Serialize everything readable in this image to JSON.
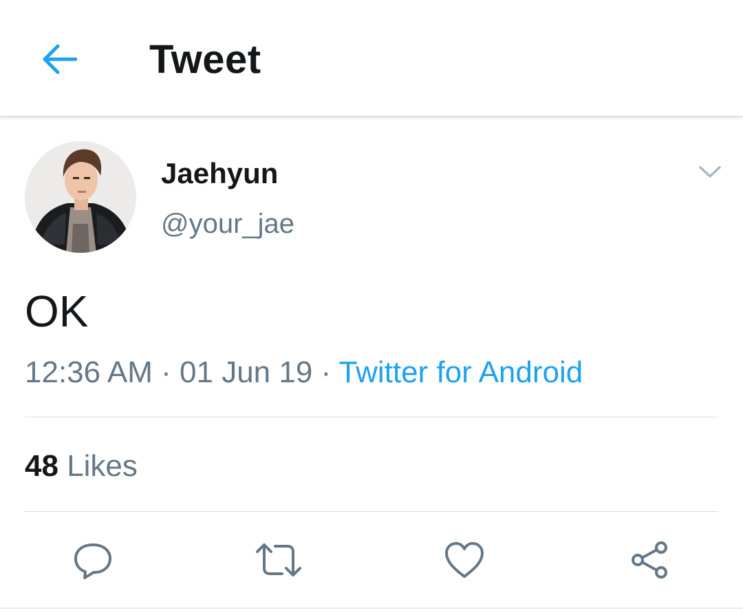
{
  "header": {
    "title": "Tweet",
    "back_icon": "arrow-left-icon",
    "accent_color": "#1da1f2"
  },
  "tweet": {
    "author": {
      "display_name": "Jaehyun",
      "handle": "@your_jae",
      "avatar_icon": "profile-photo"
    },
    "text": "OK",
    "meta": {
      "time": "12:36 AM",
      "separator": "·",
      "date": "01 Jun 19",
      "source": "Twitter for Android"
    },
    "stats": {
      "likes_count": "48",
      "likes_label": "Likes"
    }
  },
  "actions": [
    {
      "icon": "reply-icon"
    },
    {
      "icon": "retweet-icon"
    },
    {
      "icon": "like-icon"
    },
    {
      "icon": "share-icon"
    }
  ],
  "colors": {
    "text_primary": "#14171a",
    "text_secondary": "#657786",
    "link": "#1da1f2",
    "divider": "#d9dde1"
  }
}
